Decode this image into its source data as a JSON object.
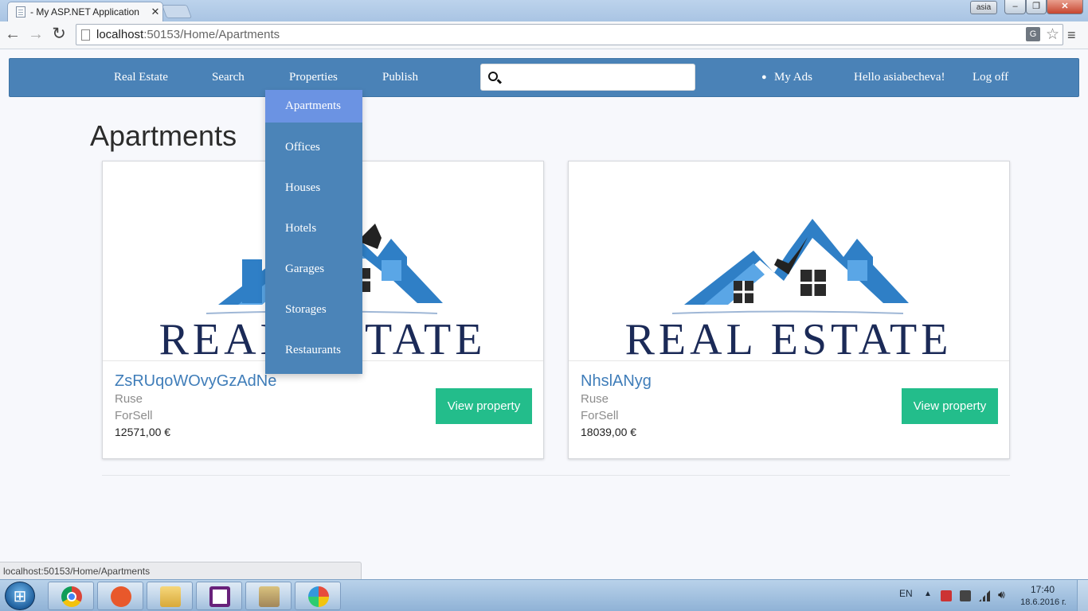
{
  "browser": {
    "tab_title": "- My ASP.NET Application",
    "tab_close": "✕",
    "user_badge": "asia",
    "url_host": "localhost",
    "url_rest": ":50153/Home/Apartments",
    "status_url": "localhost:50153/Home/Apartments",
    "translate_icon": "translate-icon",
    "star_icon": "bookmark-star-icon"
  },
  "navbar": {
    "brand": "Real Estate",
    "search": "Search",
    "properties": "Properties",
    "publish": "Publish",
    "search_placeholder": "",
    "my_ads": "My Ads",
    "hello": "Hello asiabecheva!",
    "logoff": "Log off",
    "color": "#4a82b7"
  },
  "dropdown": {
    "items": [
      "Apartments",
      "Offices",
      "Houses",
      "Hotels",
      "Garages",
      "Storages",
      "Restaurants"
    ],
    "active_color": "#6b93e3"
  },
  "page": {
    "title": "Apartments"
  },
  "logo_text": "REAL ESTATE",
  "cards": [
    {
      "title": "ZsRUqoWOvyGzAdNe",
      "city": "Ruse",
      "type": "ForSell",
      "price": "12571,00 €",
      "button": "View property"
    },
    {
      "title": "NhslANyg",
      "city": "Ruse",
      "type": "ForSell",
      "price": "18039,00 €",
      "button": "View property"
    }
  ],
  "taskbar": {
    "apps": [
      "chrome-icon",
      "git-icon",
      "file-explorer-icon",
      "visual-studio-icon",
      "tools-icon",
      "picasa-icon"
    ],
    "lang": "EN",
    "time": "17:40",
    "date": "18.6.2016 г."
  },
  "colors": {
    "button_green": "#23bd8b",
    "title_blue": "#3f7db9",
    "logo_navy": "#1b2a57"
  }
}
